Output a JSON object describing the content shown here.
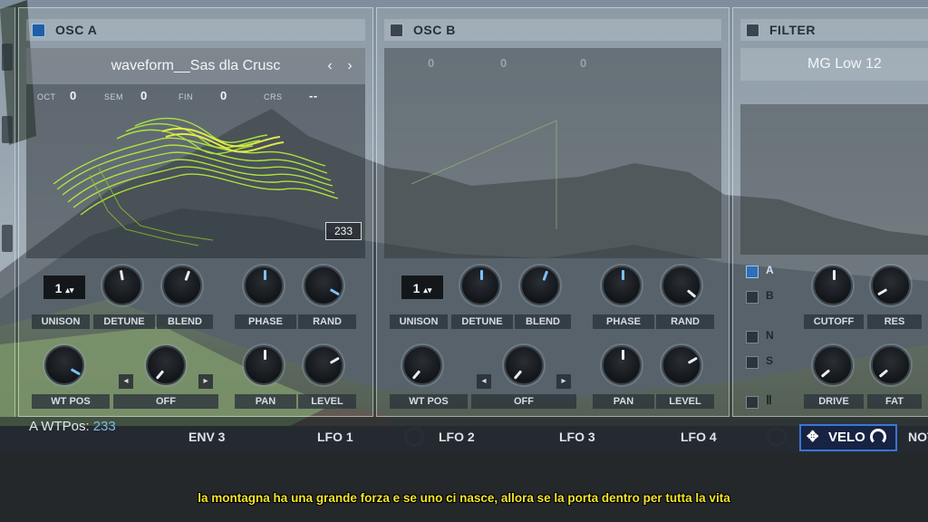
{
  "osc_a": {
    "title": "OSC A",
    "enabled": true,
    "waveform_name": "waveform__Sas dla Crusc",
    "prev_icon": "chevron-left-icon",
    "next_icon": "chevron-right-icon",
    "params": [
      {
        "label": "OCT",
        "value": "0"
      },
      {
        "label": "SEM",
        "value": "0"
      },
      {
        "label": "FIN",
        "value": "0"
      },
      {
        "label": "CRS",
        "value": "--"
      }
    ],
    "wt_frame": "233",
    "unison_value": "1",
    "labels": [
      "UNISON",
      "DETUNE",
      "BLEND",
      "PHASE",
      "RAND",
      "WT POS",
      "OFF",
      "PAN",
      "LEVEL"
    ]
  },
  "osc_b": {
    "title": "OSC B",
    "enabled": false,
    "params": [
      {
        "value": "0"
      },
      {
        "value": "0"
      },
      {
        "value": "0"
      }
    ],
    "unison_value": "1",
    "labels": [
      "UNISON",
      "DETUNE",
      "BLEND",
      "PHASE",
      "RAND",
      "WT POS",
      "OFF",
      "PAN",
      "LEVEL"
    ]
  },
  "filter": {
    "title": "FILTER",
    "enabled": false,
    "type": "MG Low 12",
    "routing": [
      {
        "label": "A",
        "on": true
      },
      {
        "label": "B",
        "on": false
      },
      {
        "label": "N",
        "on": false
      },
      {
        "label": "S",
        "on": false
      }
    ],
    "labels": [
      "CUTOFF",
      "RES",
      "DRIVE",
      "FAT"
    ]
  },
  "status": {
    "wtpos_label": "A WTPos:",
    "wtpos_value": "233"
  },
  "mod_tabs": [
    "ENV 3",
    "LFO 1",
    "LFO 2",
    "LFO 3",
    "LFO 4",
    "VELO",
    "NOT"
  ],
  "subtitle": "la montagna ha una grande forza e se uno ci nasce, allora se la porta dentro per tutta la vita",
  "colors": {
    "accent": "#3c74d8",
    "wavetable": "#b6f23a",
    "subtitle": "#f4e62a"
  }
}
